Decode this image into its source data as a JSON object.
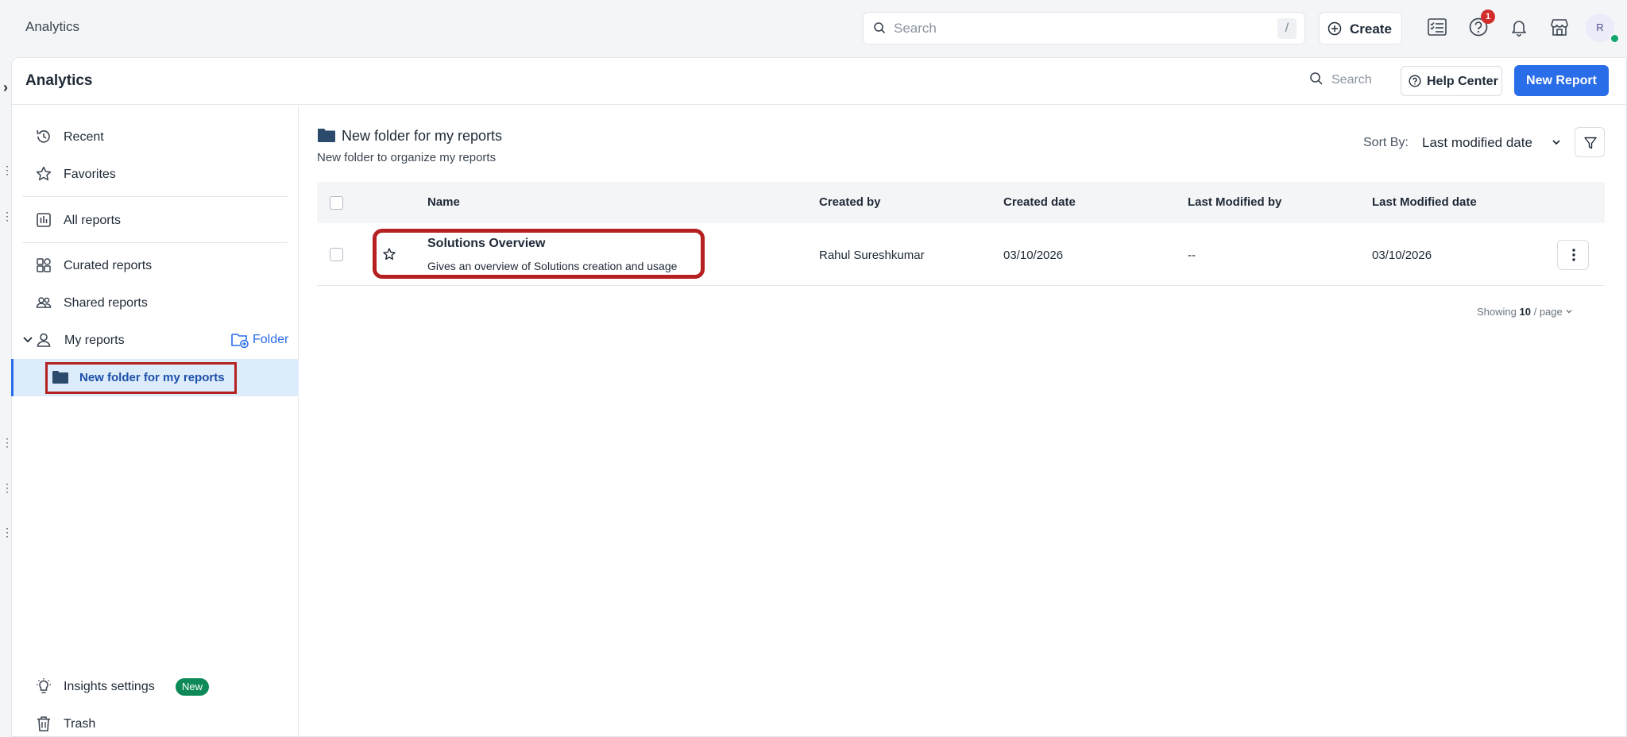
{
  "topbar": {
    "app_title": "Analytics",
    "search_placeholder": "Search",
    "search_shortcut": "/",
    "create_label": "Create",
    "help_badge_count": "1",
    "avatar_initial": "R",
    "icons": [
      "search-icon",
      "plus-circle-icon",
      "tasks-icon",
      "help-icon",
      "bell-icon",
      "store-icon"
    ]
  },
  "header": {
    "title": "Analytics",
    "search_label": "Search",
    "help_center_label": "Help Center",
    "new_report_label": "New Report"
  },
  "sidebar": {
    "recent": "Recent",
    "favorites": "Favorites",
    "all_reports": "All reports",
    "curated_reports": "Curated reports",
    "shared_reports": "Shared reports",
    "my_reports": "My reports",
    "folder_link": "Folder",
    "selected_folder": "New folder for my reports",
    "insights_settings": "Insights settings",
    "new_badge": "New",
    "trash": "Trash"
  },
  "main": {
    "folder_title": "New folder for my reports",
    "folder_description": "New folder to organize my reports",
    "sort_label": "Sort By:",
    "sort_value": "Last modified date",
    "columns": [
      "Name",
      "Created by",
      "Created date",
      "Last Modified by",
      "Last Modified date"
    ],
    "rows": [
      {
        "name": "Solutions Overview",
        "description": "Gives an overview of Solutions creation and usage",
        "created_by": "Rahul Sureshkumar",
        "created_date": "03/10/2026",
        "last_modified_by": "--",
        "last_modified_date": "03/10/2026"
      }
    ],
    "paging_prefix": "Showing",
    "paging_count": "10",
    "paging_suffix": "/ page"
  },
  "colors": {
    "accent": "#2a6de8",
    "highlight": "#b52020",
    "selected_bg": "#dcecfb",
    "new_badge": "#0d8a57",
    "notification": "#d12d2d"
  }
}
